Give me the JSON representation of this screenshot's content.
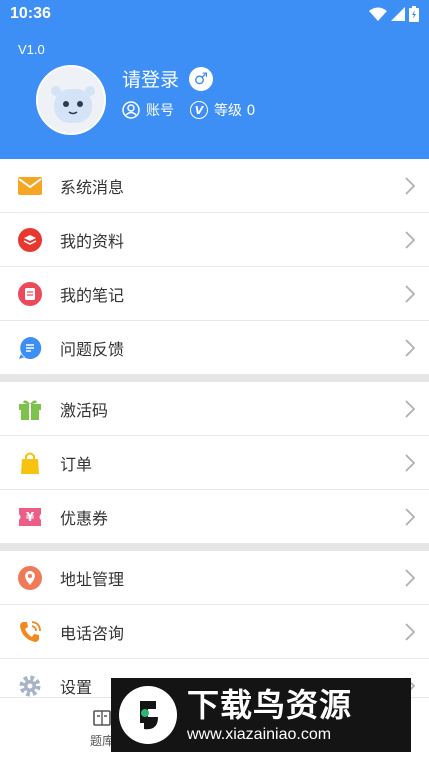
{
  "status_bar": {
    "time": "10:36"
  },
  "header": {
    "version": "V1.0",
    "login_label": "请登录",
    "gender_symbol": "♂",
    "account_label": "账号",
    "level_label": "等级 0",
    "level_icon_letter": "V"
  },
  "menu": {
    "items": [
      {
        "label": "系统消息",
        "icon": "mail-icon",
        "color": "#f5a623"
      },
      {
        "label": "我的资料",
        "icon": "layers-icon",
        "color": "#e8372f"
      },
      {
        "label": "我的笔记",
        "icon": "note-icon",
        "color": "#ec4a5a"
      },
      {
        "label": "问题反馈",
        "icon": "feedback-icon",
        "color": "#3d8ff5"
      },
      {
        "label": "激活码",
        "icon": "gift-icon",
        "color": "#7dc24b"
      },
      {
        "label": "订单",
        "icon": "shopping-bag-icon",
        "color": "#f6c310"
      },
      {
        "label": "优惠券",
        "icon": "coupon-icon",
        "color": "#ec5e87"
      },
      {
        "label": "地址管理",
        "icon": "location-pin-icon",
        "color": "#f07a58"
      },
      {
        "label": "电话咨询",
        "icon": "phone-icon",
        "color": "#f08a1f"
      },
      {
        "label": "设置",
        "icon": "settings-icon",
        "color": "#a7b4c6"
      }
    ],
    "coupon_symbol": "¥"
  },
  "bottom_nav": {
    "partial_label": "题库"
  },
  "watermark": {
    "title": "下载鸟资源",
    "url": "www.xiazainiao.com"
  }
}
